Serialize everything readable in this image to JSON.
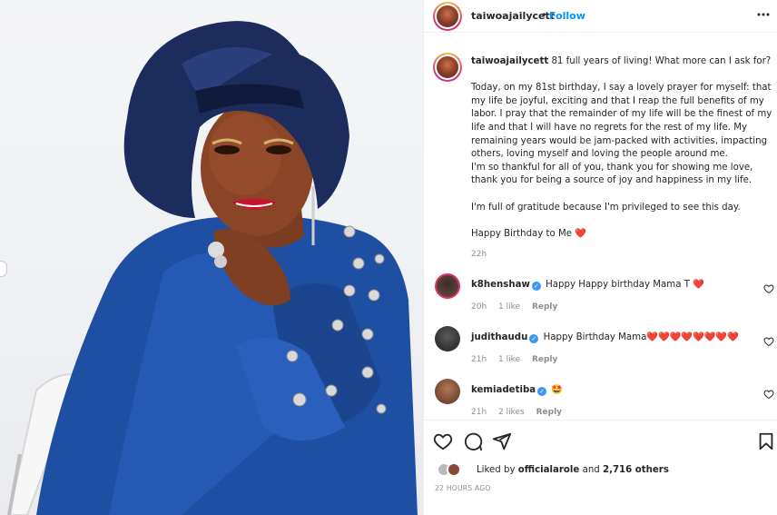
{
  "post": {
    "username": "taiwoajailycett",
    "follow_label": "Follow",
    "separator": "•"
  },
  "caption": {
    "username": "taiwoajailycett",
    "first_line": "81 full years of living! What more can I ask for?",
    "para1": "Today, on my 81st birthday, I say a lovely prayer for myself: that my life be joyful, exciting and that I reap the full benefits of my labor. I pray that the remainder of my life will be the finest of my life and that I will have no regrets for the rest of my life. My remaining years would be jam-packed with activities, impacting others, loving myself and loving the people around me.",
    "para2": "I'm so thankful for all of you, thank you for showing me love, thank you for being a source of joy and happiness in my life.",
    "para3": "I'm full of gratitude because I'm privileged to see this day.",
    "para4": "Happy Birthday to Me",
    "para4_emoji": "❤️",
    "time": "22h"
  },
  "comments": [
    {
      "username": "k8henshaw",
      "text": "Happy Happy birthday Mama T",
      "emoji": "❤️",
      "time": "20h",
      "likes": "1 like",
      "reply": "Reply"
    },
    {
      "username": "judithaudu",
      "text": "Happy Birthday Mama",
      "emoji": "❤️❤️❤️❤️❤️❤️❤️❤️",
      "time": "21h",
      "likes": "1 like",
      "reply": "Reply"
    },
    {
      "username": "kemiadetiba",
      "text": "",
      "emoji": "🤩",
      "time": "21h",
      "likes": "2 likes",
      "reply": "Reply"
    }
  ],
  "likes": {
    "prefix": "Liked by",
    "user": "officialarole",
    "middle": "and",
    "count": "2,716 others"
  },
  "time_ago": "22 HOURS AGO",
  "colors": {
    "link_blue": "#0095f6",
    "heart_red": "#e0245e",
    "muted": "#8e8e8e",
    "dress_blue": "#1f4fa3",
    "gele_navy": "#1c2c5c"
  },
  "icons": [
    "more-icon",
    "heart-icon",
    "comment-icon",
    "share-icon",
    "bookmark-icon",
    "verified-icon"
  ]
}
